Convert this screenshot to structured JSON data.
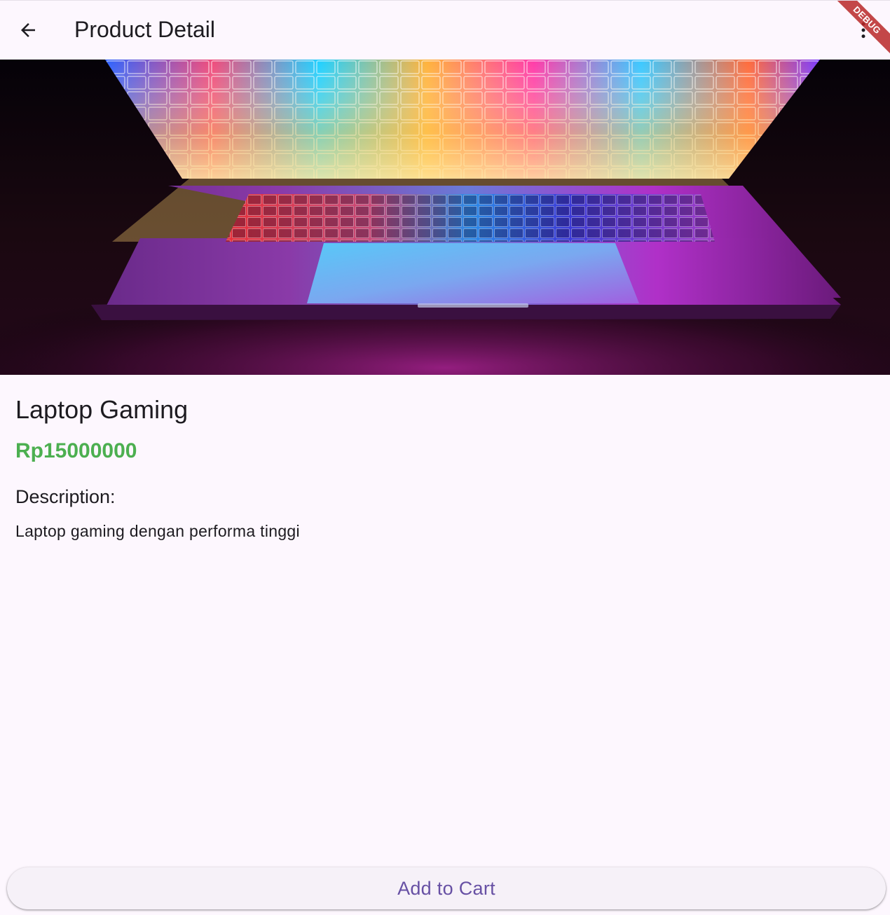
{
  "appbar": {
    "back_icon": "arrow-back-icon",
    "title": "Product Detail",
    "menu_icon": "more-vert-icon",
    "debug_banner": "DEBUG"
  },
  "product": {
    "image": "laptop-photo",
    "name": "Laptop Gaming",
    "price": "Rp15000000",
    "price_color": "#4caf50",
    "description_heading": "Description:",
    "description": "Laptop gaming dengan performa tinggi"
  },
  "actions": {
    "add_to_cart_label": "Add to Cart",
    "accent_color": "#6750a4"
  }
}
